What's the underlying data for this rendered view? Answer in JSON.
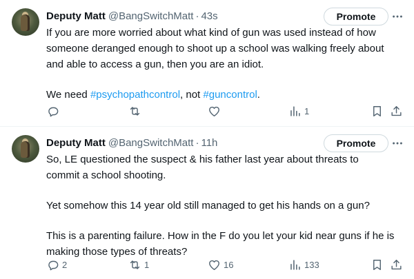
{
  "tweets": [
    {
      "author_name": "Deputy Matt",
      "handle": "@BangSwitchMatt",
      "separator": "·",
      "time": "43s",
      "promote_label": "Promote",
      "lines": [
        "If you are more worried about what kind of gun was used instead of how",
        "someone deranged enough to shoot up a school was walking freely about",
        "and able to access a gun, then you are an idiot."
      ],
      "last_line": {
        "prefix": "We need ",
        "hashtag1": "#psychopathcontrol",
        "middle": ", not ",
        "hashtag2": "#guncontrol",
        "suffix": "."
      },
      "actions": {
        "replies": "",
        "reposts": "",
        "likes": "",
        "views": "1"
      }
    },
    {
      "author_name": "Deputy Matt",
      "handle": "@BangSwitchMatt",
      "separator": "·",
      "time": "11h",
      "promote_label": "Promote",
      "paragraphs": [
        [
          "So, LE questioned the suspect & his father last year about threats to",
          "commit a school shooting."
        ],
        [
          "Yet somehow this 14 year old still managed to get his hands on a gun?"
        ],
        [
          "This is a parenting failure. How in the F do you let your kid near guns if he is",
          "making those types of threats?"
        ]
      ],
      "actions": {
        "replies": "2",
        "reposts": "1",
        "likes": "16",
        "views": "133"
      }
    }
  ],
  "icons": {
    "reply": "reply-icon",
    "repost": "repost-icon",
    "like": "like-icon",
    "views": "views-icon",
    "bookmark": "bookmark-icon",
    "share": "share-icon",
    "more": "more-icon"
  },
  "colors": {
    "text": "#0f1419",
    "secondary": "#536471",
    "hashtag": "#1d9bf0",
    "border": "#cfd9de",
    "divider": "#eff3f4"
  }
}
